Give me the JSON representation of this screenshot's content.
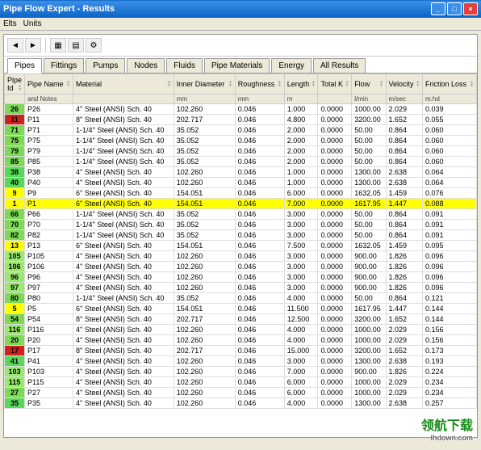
{
  "window": {
    "title": "Pipe Flow Expert - Results"
  },
  "menu": {
    "elts": "Elts",
    "units": "Units"
  },
  "toolbar_icons": [
    "prev",
    "next",
    "csv",
    "xls",
    "cfg"
  ],
  "tabs": [
    {
      "label": "Pipes",
      "active": true
    },
    {
      "label": "Fittings"
    },
    {
      "label": "Pumps"
    },
    {
      "label": "Nodes"
    },
    {
      "label": "Fluids"
    },
    {
      "label": "Pipe Materials"
    },
    {
      "label": "Energy"
    },
    {
      "label": "All Results"
    }
  ],
  "columns": [
    {
      "h": "Pipe Id",
      "u": ""
    },
    {
      "h": "Pipe Name",
      "u": "and Notes"
    },
    {
      "h": "Material",
      "u": ""
    },
    {
      "h": "Inner Diameter",
      "u": "mm"
    },
    {
      "h": "Roughness",
      "u": "mm"
    },
    {
      "h": "Length",
      "u": "m"
    },
    {
      "h": "Total K",
      "u": ""
    },
    {
      "h": "Flow",
      "u": "l/min"
    },
    {
      "h": "Velocity",
      "u": "m/sec"
    },
    {
      "h": "Friction Loss",
      "u": "m.hd"
    }
  ],
  "rows": [
    {
      "id": "26",
      "c": "c-g1",
      "n": "P26",
      "m": "4'' Steel (ANSI) Sch. 40",
      "d": "102.260",
      "r": "0.046",
      "l": "1.000",
      "k": "0.0000",
      "f": "1000.00",
      "v": "2.029",
      "fl": "0.039"
    },
    {
      "id": "11",
      "c": "c-r",
      "n": "P11",
      "m": "8'' Steel (ANSI) Sch. 40",
      "d": "202.717",
      "r": "0.046",
      "l": "4.800",
      "k": "0.0000",
      "f": "3200.00",
      "v": "1.652",
      "fl": "0.055"
    },
    {
      "id": "71",
      "c": "c-g1",
      "n": "P71",
      "m": "1-1/4'' Steel (ANSI) Sch. 40",
      "d": "35.052",
      "r": "0.046",
      "l": "2.000",
      "k": "0.0000",
      "f": "50.00",
      "v": "0.864",
      "fl": "0.060"
    },
    {
      "id": "75",
      "c": "c-g1",
      "n": "P75",
      "m": "1-1/4'' Steel (ANSI) Sch. 40",
      "d": "35.052",
      "r": "0.046",
      "l": "2.000",
      "k": "0.0000",
      "f": "50.00",
      "v": "0.864",
      "fl": "0.060"
    },
    {
      "id": "79",
      "c": "c-g1",
      "n": "P79",
      "m": "1-1/4'' Steel (ANSI) Sch. 40",
      "d": "35.052",
      "r": "0.046",
      "l": "2.000",
      "k": "0.0000",
      "f": "50.00",
      "v": "0.864",
      "fl": "0.060"
    },
    {
      "id": "85",
      "c": "c-g1",
      "n": "P85",
      "m": "1-1/4'' Steel (ANSI) Sch. 40",
      "d": "35.052",
      "r": "0.046",
      "l": "2.000",
      "k": "0.0000",
      "f": "50.00",
      "v": "0.864",
      "fl": "0.060"
    },
    {
      "id": "38",
      "c": "c-g2",
      "n": "P38",
      "m": "4'' Steel (ANSI) Sch. 40",
      "d": "102.260",
      "r": "0.046",
      "l": "1.000",
      "k": "0.0000",
      "f": "1300.00",
      "v": "2.638",
      "fl": "0.064"
    },
    {
      "id": "40",
      "c": "c-g2",
      "n": "P40",
      "m": "4'' Steel (ANSI) Sch. 40",
      "d": "102.260",
      "r": "0.046",
      "l": "1.000",
      "k": "0.0000",
      "f": "1300.00",
      "v": "2.638",
      "fl": "0.064"
    },
    {
      "id": "9",
      "c": "c-y",
      "n": "P9",
      "m": "6'' Steel (ANSI) Sch. 40",
      "d": "154.051",
      "r": "0.046",
      "l": "6.000",
      "k": "0.0000",
      "f": "1632.05",
      "v": "1.459",
      "fl": "0.076"
    },
    {
      "id": "1",
      "c": "c-y",
      "hl": true,
      "n": "P1",
      "m": "6'' Steel (ANSI) Sch. 40",
      "d": "154.051",
      "r": "0.046",
      "l": "7.000",
      "k": "0.0000",
      "f": "1617.95",
      "v": "1.447",
      "fl": "0.088"
    },
    {
      "id": "66",
      "c": "c-g1",
      "n": "P66",
      "m": "1-1/4'' Steel (ANSI) Sch. 40",
      "d": "35.052",
      "r": "0.046",
      "l": "3.000",
      "k": "0.0000",
      "f": "50.00",
      "v": "0.864",
      "fl": "0.091"
    },
    {
      "id": "70",
      "c": "c-g1",
      "n": "P70",
      "m": "1-1/4'' Steel (ANSI) Sch. 40",
      "d": "35.052",
      "r": "0.046",
      "l": "3.000",
      "k": "0.0000",
      "f": "50.00",
      "v": "0.864",
      "fl": "0.091"
    },
    {
      "id": "82",
      "c": "c-g1",
      "n": "P82",
      "m": "1-1/4'' Steel (ANSI) Sch. 40",
      "d": "35.052",
      "r": "0.046",
      "l": "3.000",
      "k": "0.0000",
      "f": "50.00",
      "v": "0.864",
      "fl": "0.091"
    },
    {
      "id": "13",
      "c": "c-y",
      "n": "P13",
      "m": "6'' Steel (ANSI) Sch. 40",
      "d": "154.051",
      "r": "0.046",
      "l": "7.500",
      "k": "0.0000",
      "f": "1632.05",
      "v": "1.459",
      "fl": "0.095"
    },
    {
      "id": "105",
      "c": "c-g3",
      "n": "P105",
      "m": "4'' Steel (ANSI) Sch. 40",
      "d": "102.260",
      "r": "0.046",
      "l": "3.000",
      "k": "0.0000",
      "f": "900.00",
      "v": "1.826",
      "fl": "0.096"
    },
    {
      "id": "106",
      "c": "c-g3",
      "n": "P106",
      "m": "4'' Steel (ANSI) Sch. 40",
      "d": "102.260",
      "r": "0.046",
      "l": "3.000",
      "k": "0.0000",
      "f": "900.00",
      "v": "1.826",
      "fl": "0.096"
    },
    {
      "id": "96",
      "c": "c-g3",
      "n": "P96",
      "m": "4'' Steel (ANSI) Sch. 40",
      "d": "102.260",
      "r": "0.046",
      "l": "3.000",
      "k": "0.0000",
      "f": "900.00",
      "v": "1.826",
      "fl": "0.096"
    },
    {
      "id": "97",
      "c": "c-g3",
      "n": "P97",
      "m": "4'' Steel (ANSI) Sch. 40",
      "d": "102.260",
      "r": "0.046",
      "l": "3.000",
      "k": "0.0000",
      "f": "900.00",
      "v": "1.826",
      "fl": "0.096"
    },
    {
      "id": "80",
      "c": "c-g1",
      "n": "P80",
      "m": "1-1/4'' Steel (ANSI) Sch. 40",
      "d": "35.052",
      "r": "0.046",
      "l": "4.000",
      "k": "0.0000",
      "f": "50.00",
      "v": "0.864",
      "fl": "0.121"
    },
    {
      "id": "5",
      "c": "c-y",
      "n": "P5",
      "m": "6'' Steel (ANSI) Sch. 40",
      "d": "154.051",
      "r": "0.046",
      "l": "11.500",
      "k": "0.0000",
      "f": "1617.95",
      "v": "1.447",
      "fl": "0.144"
    },
    {
      "id": "54",
      "c": "c-g1",
      "n": "P54",
      "m": "8'' Steel (ANSI) Sch. 40",
      "d": "202.717",
      "r": "0.046",
      "l": "12.500",
      "k": "0.0000",
      "f": "3200.00",
      "v": "1.652",
      "fl": "0.144"
    },
    {
      "id": "116",
      "c": "c-g3",
      "n": "P116",
      "m": "4'' Steel (ANSI) Sch. 40",
      "d": "102.260",
      "r": "0.046",
      "l": "4.000",
      "k": "0.0000",
      "f": "1000.00",
      "v": "2.029",
      "fl": "0.156"
    },
    {
      "id": "20",
      "c": "c-g1",
      "n": "P20",
      "m": "4'' Steel (ANSI) Sch. 40",
      "d": "102.260",
      "r": "0.046",
      "l": "4.000",
      "k": "0.0000",
      "f": "1000.00",
      "v": "2.029",
      "fl": "0.156"
    },
    {
      "id": "17",
      "c": "c-r",
      "n": "P17",
      "m": "8'' Steel (ANSI) Sch. 40",
      "d": "202.717",
      "r": "0.046",
      "l": "15.000",
      "k": "0.0000",
      "f": "3200.00",
      "v": "1.652",
      "fl": "0.173"
    },
    {
      "id": "41",
      "c": "c-g2",
      "n": "P41",
      "m": "4'' Steel (ANSI) Sch. 40",
      "d": "102.260",
      "r": "0.046",
      "l": "3.000",
      "k": "0.0000",
      "f": "1300.00",
      "v": "2.638",
      "fl": "0.193"
    },
    {
      "id": "103",
      "c": "c-g3",
      "n": "P103",
      "m": "4'' Steel (ANSI) Sch. 40",
      "d": "102.260",
      "r": "0.046",
      "l": "7.000",
      "k": "0.0000",
      "f": "900.00",
      "v": "1.826",
      "fl": "0.224"
    },
    {
      "id": "115",
      "c": "c-g3",
      "n": "P115",
      "m": "4'' Steel (ANSI) Sch. 40",
      "d": "102.260",
      "r": "0.046",
      "l": "6.000",
      "k": "0.0000",
      "f": "1000.00",
      "v": "2.029",
      "fl": "0.234"
    },
    {
      "id": "27",
      "c": "c-g1",
      "n": "P27",
      "m": "4'' Steel (ANSI) Sch. 40",
      "d": "102.260",
      "r": "0.046",
      "l": "6.000",
      "k": "0.0000",
      "f": "1000.00",
      "v": "2.029",
      "fl": "0.234"
    },
    {
      "id": "35",
      "c": "c-g2",
      "n": "P35",
      "m": "4'' Steel (ANSI) Sch. 40",
      "d": "102.260",
      "r": "0.046",
      "l": "4.000",
      "k": "0.0000",
      "f": "1300.00",
      "v": "2.638",
      "fl": "0.257"
    }
  ],
  "watermark": {
    "text": "领航下载",
    "url": "lhdown.com"
  }
}
